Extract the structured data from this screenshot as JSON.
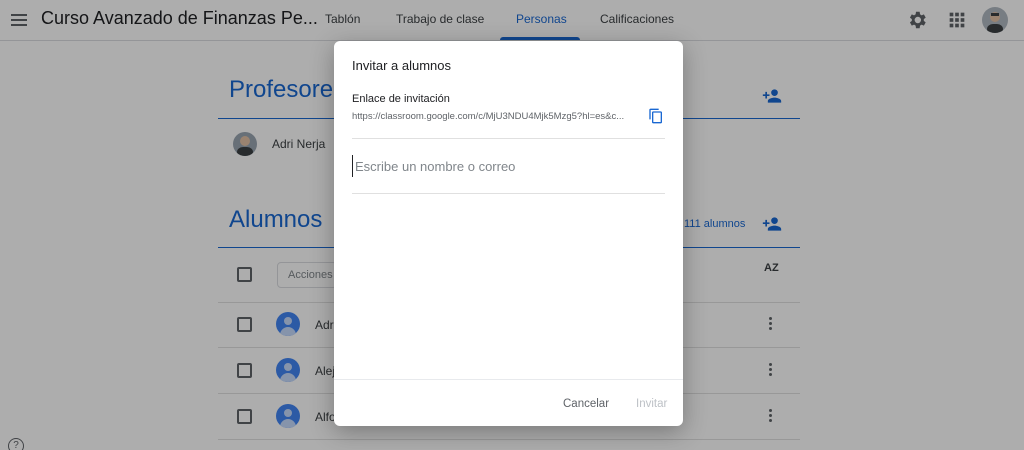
{
  "header": {
    "course_title": "Curso Avanzado de Finanzas Pe...",
    "tabs": [
      {
        "label": "Tablón"
      },
      {
        "label": "Trabajo de clase"
      },
      {
        "label": "Personas",
        "active": true
      },
      {
        "label": "Calificaciones"
      }
    ],
    "icons": [
      "menu-icon",
      "settings-gear-icon",
      "apps-grid-icon",
      "account-avatar"
    ]
  },
  "teachers": {
    "title": "Profesore",
    "names": [
      "Adri Nerja"
    ]
  },
  "students": {
    "title": "Alumnos",
    "count_label": "111 alumnos",
    "actions_placeholder": "Acciones",
    "sort_label": "AZ",
    "rows": [
      {
        "name": "Adr"
      },
      {
        "name": "Alej"
      },
      {
        "name": "Alfo"
      }
    ]
  },
  "dialog": {
    "title": "Invitar a alumnos",
    "link_label": "Enlace de invitación",
    "link_url": "https://classroom.google.com/c/MjU3NDU4Mjk5Mzg5?hl=es&c...",
    "input_placeholder": "Escribe un nombre o correo",
    "cancel_label": "Cancelar",
    "invite_label": "Invitar"
  },
  "colors": {
    "accent": "#1967d2",
    "scrim": "rgba(0,0,0,0.32)",
    "disabled": "#bdc1c6"
  }
}
